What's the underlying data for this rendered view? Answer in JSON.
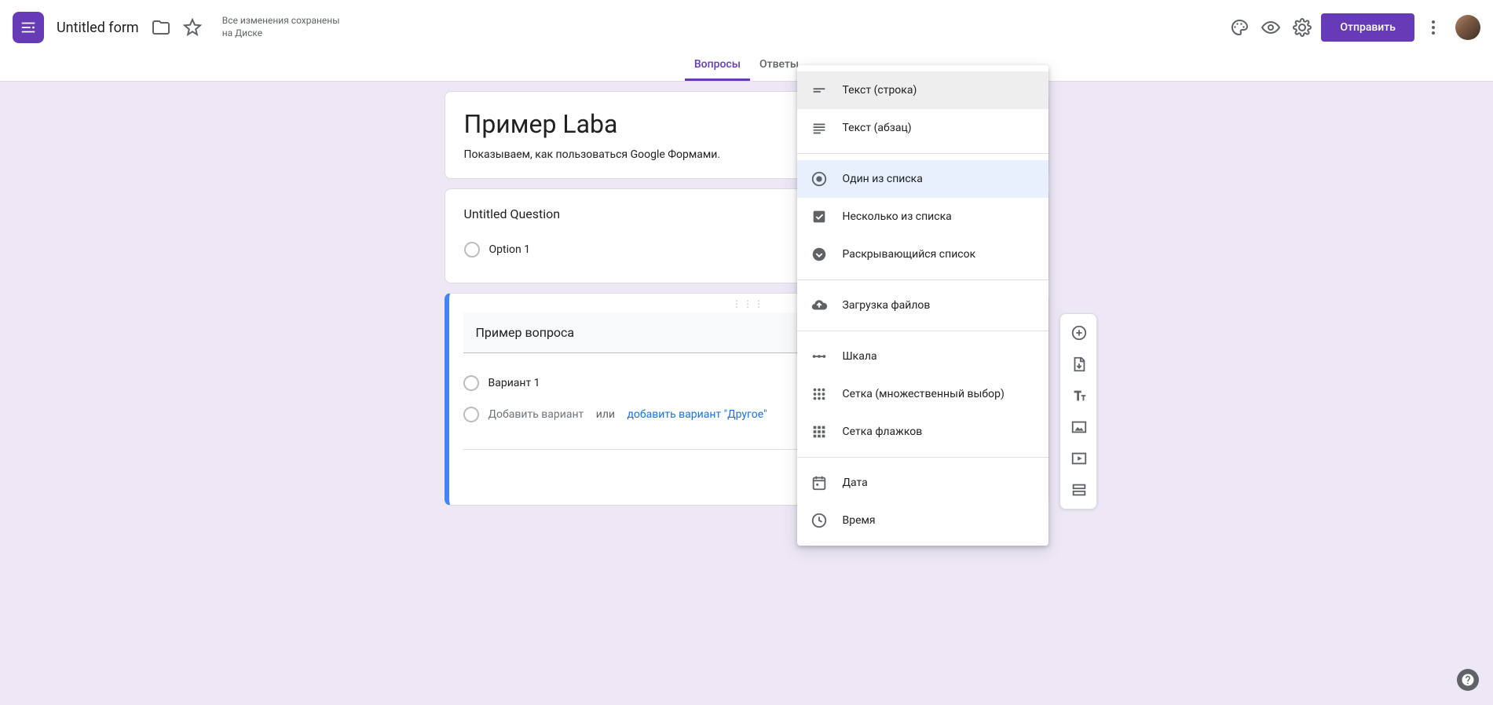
{
  "colors": {
    "accent": "#673ab7",
    "canvas_bg": "#ede7f6",
    "active_border": "#4285f4",
    "link": "#1a73e8"
  },
  "header": {
    "form_title": "Untitled form",
    "save_status_line1": "Все изменения сохранены",
    "save_status_line2": "на Диске",
    "send_label": "Отправить",
    "icons": {
      "palette": "palette-icon",
      "preview": "eye-icon",
      "settings": "gear-icon",
      "more": "more-vert-icon"
    }
  },
  "tabs": [
    {
      "label": "Вопросы",
      "active": true
    },
    {
      "label": "Ответы",
      "active": false
    }
  ],
  "title_card": {
    "title": "Пример Laba",
    "subtitle": "Показываем, как пользоваться Google Формами."
  },
  "question_card": {
    "title": "Untitled Question",
    "options": [
      {
        "label": "Option 1"
      }
    ]
  },
  "active_question": {
    "question_text": "Пример вопроса",
    "options": [
      {
        "label": "Вариант 1"
      }
    ],
    "add_option_placeholder": "Добавить вариант",
    "or": "или",
    "add_other": "добавить вариант \"Другое\""
  },
  "side_toolbar": {
    "add_question": "add-circle-icon",
    "import_questions": "import-icon",
    "add_title": "title-icon",
    "add_image": "image-icon",
    "add_video": "video-icon",
    "add_section": "section-icon"
  },
  "type_menu": {
    "groups": [
      [
        {
          "id": "short-answer",
          "label": "Текст (строка)",
          "icon": "short-text-icon",
          "state": "hovered"
        },
        {
          "id": "paragraph",
          "label": "Текст (абзац)",
          "icon": "subject-icon"
        }
      ],
      [
        {
          "id": "multiple-choice",
          "label": "Один из списка",
          "icon": "radio-icon",
          "state": "selected"
        },
        {
          "id": "checkboxes",
          "label": "Несколько из списка",
          "icon": "checkbox-icon"
        },
        {
          "id": "dropdown",
          "label": "Раскрывающийся список",
          "icon": "dropdown-circle-icon"
        }
      ],
      [
        {
          "id": "file-upload",
          "label": "Загрузка файлов",
          "icon": "cloud-upload-icon"
        }
      ],
      [
        {
          "id": "linear-scale",
          "label": "Шкала",
          "icon": "linear-scale-icon"
        },
        {
          "id": "mc-grid",
          "label": "Сетка (множественный выбор)",
          "icon": "grid-dots-icon"
        },
        {
          "id": "cb-grid",
          "label": "Сетка флажков",
          "icon": "grid-squares-icon"
        }
      ],
      [
        {
          "id": "date",
          "label": "Дата",
          "icon": "calendar-icon"
        },
        {
          "id": "time",
          "label": "Время",
          "icon": "clock-icon"
        }
      ]
    ]
  }
}
